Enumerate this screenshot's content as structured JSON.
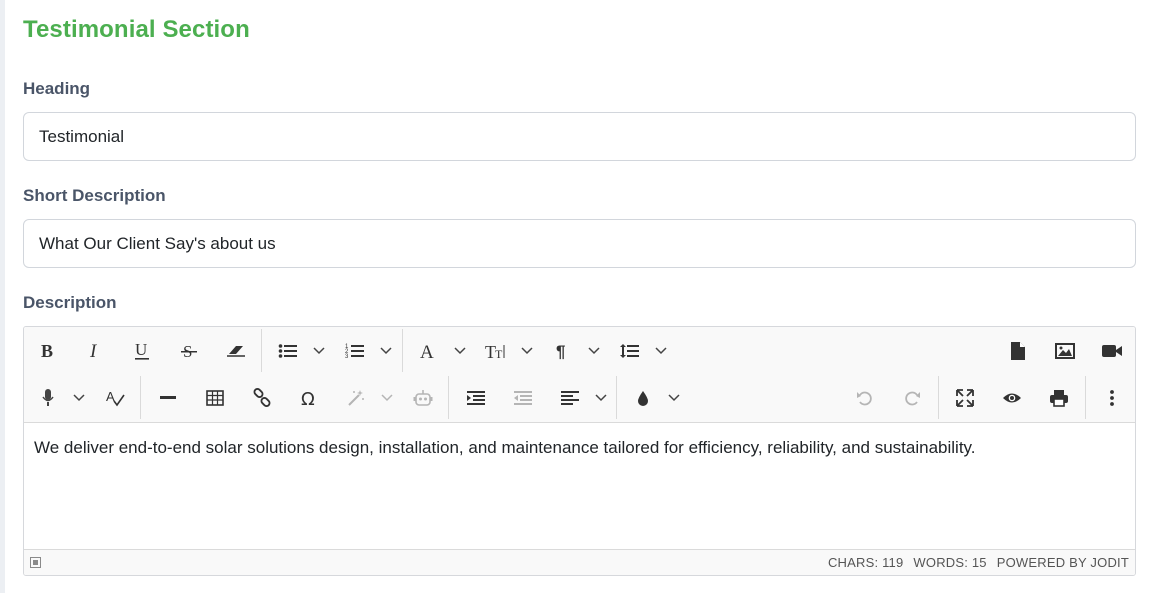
{
  "section": {
    "title": "Testimonial Section"
  },
  "fields": {
    "heading": {
      "label": "Heading",
      "value": "Testimonial"
    },
    "short_description": {
      "label": "Short Description",
      "value": "What Our Client Say's about us"
    },
    "description": {
      "label": "Description",
      "content": "We deliver end-to-end solar solutions design, installation, and maintenance tailored for efficiency, reliability, and sustainability."
    }
  },
  "editor": {
    "toolbar_row1": [
      "bold",
      "italic",
      "underline",
      "strikethrough",
      "eraser",
      "unordered-list",
      "ordered-list",
      "font",
      "font-size",
      "paragraph",
      "line-height",
      "file",
      "image",
      "video"
    ],
    "toolbar_row2": [
      "speech",
      "spellcheck",
      "horizontal-rule",
      "table",
      "link",
      "symbol",
      "ai-commands",
      "ai-assistant",
      "indent",
      "outdent",
      "align",
      "brush",
      "undo",
      "redo",
      "fullsize",
      "preview",
      "print",
      "more"
    ],
    "status": {
      "chars": "CHARS: 119",
      "words": "WORDS: 15",
      "powered": "POWERED BY JODIT"
    }
  },
  "colors": {
    "accent": "#4caf50",
    "label": "#4a5568",
    "icon": "#333333",
    "icon_disabled": "#b5b5b5"
  }
}
